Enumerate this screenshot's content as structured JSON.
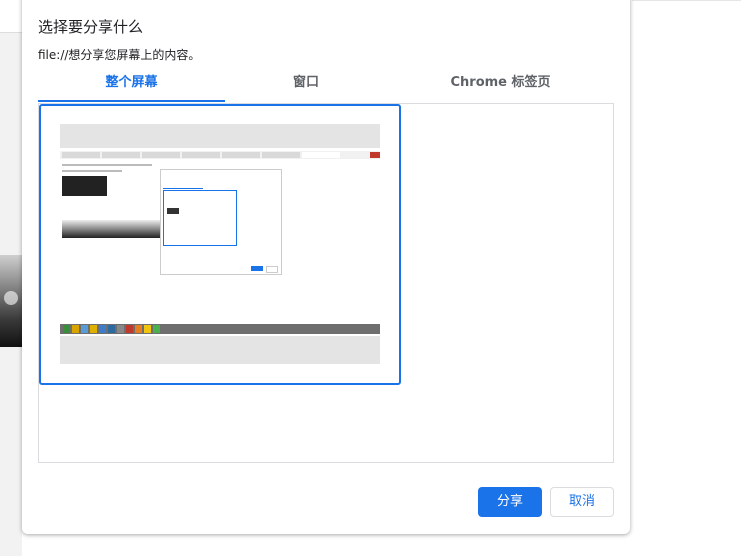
{
  "dialog": {
    "title": "选择要分享什么",
    "subtitle": "file://想分享您屏幕上的内容。",
    "tabs": [
      {
        "label": "整个屏幕",
        "active": true
      },
      {
        "label": "窗口",
        "active": false
      },
      {
        "label": "Chrome 标签页",
        "active": false
      }
    ],
    "share_label": "分享",
    "cancel_label": "取消"
  },
  "colors": {
    "accent": "#1a73e8",
    "tab_inactive": "#5f6368",
    "border": "#dadce0"
  },
  "icons": [
    "volume-icon"
  ]
}
